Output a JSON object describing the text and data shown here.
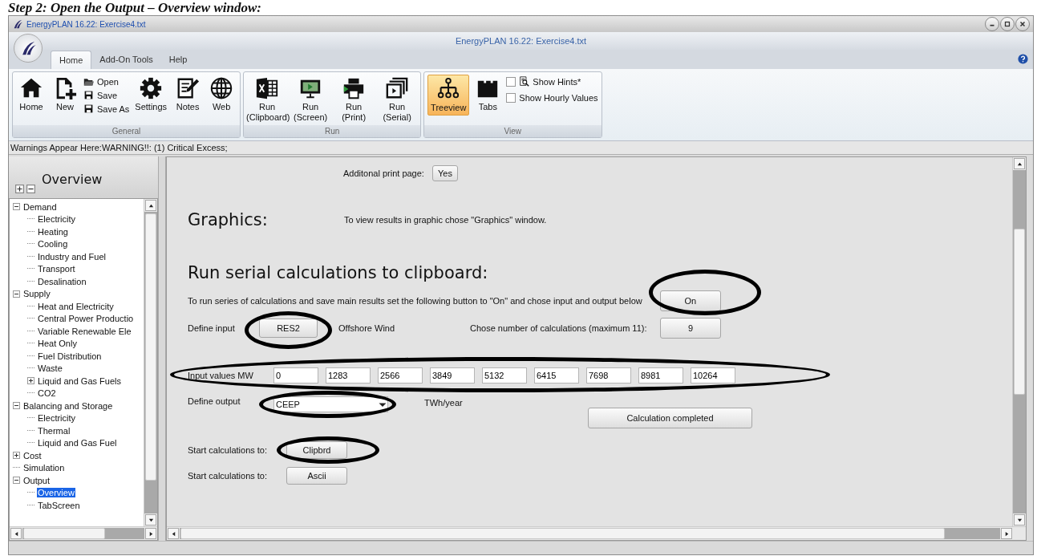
{
  "heading": "Step 2: Open the Output – Overview window:",
  "window": {
    "title": "EnergyPLAN 16.22: Exercise4.txt",
    "app_title": "EnergyPLAN 16.22:  Exercise4.txt"
  },
  "tabs": [
    {
      "label": "Home",
      "selected": true
    },
    {
      "label": "Add-On Tools",
      "selected": false
    },
    {
      "label": "Help",
      "selected": false
    }
  ],
  "ribbon_groups": [
    {
      "title": "General",
      "items": [
        {
          "kind": "large",
          "label": "Home"
        },
        {
          "kind": "large",
          "label": "New"
        },
        {
          "kind": "stack",
          "items": [
            "Open",
            "Save",
            "Save As"
          ]
        },
        {
          "kind": "large",
          "label": "Settings"
        },
        {
          "kind": "large",
          "label": "Notes"
        },
        {
          "kind": "large",
          "label": "Web"
        }
      ]
    },
    {
      "title": "Run",
      "items": [
        {
          "kind": "large",
          "label": "Run (Clipboard)"
        },
        {
          "kind": "large",
          "label": "Run (Screen)"
        },
        {
          "kind": "large",
          "label": "Run (Print)"
        },
        {
          "kind": "large",
          "label": "Run (Serial)"
        }
      ]
    },
    {
      "title": "View",
      "items": [
        {
          "kind": "toggle",
          "label": "Treeview",
          "selected": true
        },
        {
          "kind": "toggle",
          "label": "Tabs",
          "selected": false
        },
        {
          "kind": "checks",
          "items": [
            {
              "label": "Show Hints*",
              "checked": false,
              "kind": "hint"
            },
            {
              "label": "Show Hourly Values",
              "checked": false,
              "kind": "plain"
            }
          ]
        }
      ]
    }
  ],
  "warnings": "Warnings Appear Here:WARNING!!: (1) Critical Excess;",
  "sidebar": {
    "title": "Overview",
    "tree": [
      {
        "label": "Demand",
        "expanded": true,
        "selected": false,
        "children": [
          {
            "label": "Electricity",
            "selected": false
          },
          {
            "label": "Heating",
            "selected": false
          },
          {
            "label": "Cooling",
            "selected": false
          },
          {
            "label": "Industry and Fuel",
            "selected": false
          },
          {
            "label": "Transport",
            "selected": false
          },
          {
            "label": "Desalination",
            "selected": false
          }
        ]
      },
      {
        "label": "Supply",
        "expanded": true,
        "selected": false,
        "children": [
          {
            "label": "Heat and Electricity",
            "selected": false
          },
          {
            "label": "Central Power Productio",
            "selected": false
          },
          {
            "label": "Variable Renewable Ele",
            "selected": false
          },
          {
            "label": "Heat Only",
            "selected": false
          },
          {
            "label": "Fuel Distribution",
            "selected": false
          },
          {
            "label": "Waste",
            "selected": false
          },
          {
            "label": "Liquid and Gas Fuels",
            "expanded": false,
            "selected": false
          },
          {
            "label": "CO2",
            "selected": false
          }
        ]
      },
      {
        "label": "Balancing and Storage",
        "expanded": true,
        "selected": false,
        "children": [
          {
            "label": "Electricity",
            "selected": false
          },
          {
            "label": "Thermal",
            "selected": false
          },
          {
            "label": "Liquid and Gas Fuel",
            "selected": false
          }
        ]
      },
      {
        "label": "Cost",
        "expanded": false,
        "selected": false
      },
      {
        "label": "Simulation",
        "selected": false
      },
      {
        "label": "Output",
        "expanded": true,
        "selected": false,
        "children": [
          {
            "label": "Overview",
            "selected": true
          },
          {
            "label": "TabScreen",
            "selected": false
          }
        ]
      }
    ]
  },
  "content": {
    "print_page": {
      "label": "Additonal print page:",
      "button": "Yes"
    },
    "graphics": {
      "heading": "Graphics:",
      "note": "To view results in graphic chose \"Graphics\" window."
    },
    "serial": {
      "heading": "Run serial calculations to clipboard:",
      "description": "To run series of calculations and save main results set the following button to \"On\" and chose input and output below",
      "on_button": {
        "label": "On",
        "circled": true
      },
      "define_input": {
        "label": "Define input",
        "button": "RES2",
        "circled": true,
        "name": "Offshore Wind"
      },
      "count": {
        "label": "Chose number of calculations (maximum 11):",
        "button": "9"
      },
      "input_values": {
        "label": "Input values  MW",
        "circled": true,
        "values": [
          "0",
          "1283",
          "2566",
          "3849",
          "5132",
          "6415",
          "7698",
          "8981",
          "10264"
        ]
      },
      "define_output": {
        "label": "Define output",
        "value": "CEEP",
        "circled": true,
        "unit": "TWh/year"
      },
      "status_button": "Calculation completed",
      "start_rows": [
        {
          "label": "Start calculations to:",
          "button": "Clipbrd",
          "circled": true
        },
        {
          "label": "Start calculations to:",
          "button": "Ascii",
          "circled": false
        }
      ]
    }
  }
}
